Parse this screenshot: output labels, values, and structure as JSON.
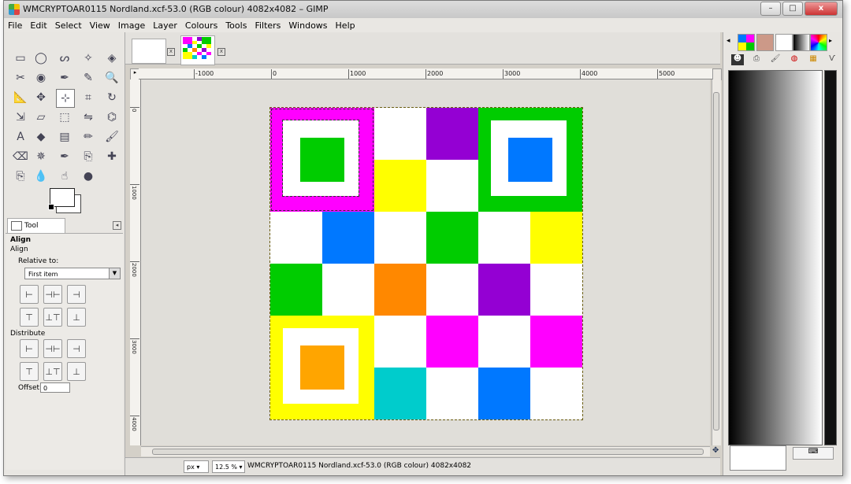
{
  "window": {
    "title": "WMCRYPTOAR0115 Nordland.xcf-53.0 (RGB colour) 4082x4082 – GIMP",
    "buttons": {
      "minimize": "–",
      "maximize": "□",
      "close": "x"
    }
  },
  "menu": [
    "File",
    "Edit",
    "Select",
    "View",
    "Image",
    "Layer",
    "Colours",
    "Tools",
    "Filters",
    "Windows",
    "Help"
  ],
  "toolbox": {
    "tools": [
      "rect-select-icon",
      "ellipse-select-icon",
      "lasso-icon",
      "fuzzy-select-icon",
      "color-select-icon",
      "scissors-icon",
      "foreground-select-icon",
      "paths-icon",
      "color-picker-icon",
      "zoom-icon",
      "measure-icon",
      "move-icon",
      "align-icon",
      "crop-icon",
      "rotate-icon",
      "scale-icon",
      "shear-icon",
      "perspective-icon",
      "flip-icon",
      "cage-icon",
      "text-icon",
      "bucket-fill-icon",
      "blend-icon",
      "pencil-icon",
      "paintbrush-icon",
      "eraser-icon",
      "airbrush-icon",
      "ink-icon",
      "clone-icon",
      "heal-icon",
      "perspective-clone-icon",
      "blur-icon",
      "smudge-icon",
      "dodge-burn-icon"
    ],
    "glyphs": [
      "▭",
      "◯",
      "ᔕ",
      "✧",
      "◈",
      "✂",
      "◉",
      "✒",
      "✎",
      "🔍",
      "📐",
      "✥",
      "⊹",
      "⌗",
      "↻",
      "⇲",
      "▱",
      "⬚",
      "⇋",
      "⌬",
      "A",
      "◆",
      "▤",
      "✏",
      "🖌",
      "⌫",
      "✵",
      "✒",
      "⎘",
      "✚",
      "⎘",
      "💧",
      "☝",
      "●"
    ],
    "selected_index": 12
  },
  "tool_options": {
    "tab_label": "Tool Options",
    "heading": "Align",
    "subheading": "Align",
    "relative_to_label": "Relative to:",
    "relative_to_value": "First item",
    "distribute_label": "Distribute",
    "offset_label": "Offset:",
    "offset_value": "0",
    "align_glyphs": [
      "⊢",
      "⊣⊢",
      "⊣",
      "⊤",
      "⊥⊤",
      "⊥"
    ]
  },
  "image_tabs": {
    "close_glyph": "x"
  },
  "ruler": {
    "h_labels": [
      "-1000",
      "0",
      "1000",
      "2000",
      "3000",
      "4000",
      "5000"
    ],
    "v_labels": [
      "0",
      "1000",
      "2000",
      "3000",
      "4000"
    ]
  },
  "image": {
    "colors": {
      "magenta": "#ff00ff",
      "green": "#00cc00",
      "purple": "#9400d3",
      "blue": "#0078ff",
      "yellow": "#ffff00",
      "orange": "#ff8800",
      "gold": "#ffa500",
      "cyan": "#00cccc",
      "white": "#ffffff"
    }
  },
  "statusbar": {
    "unit": "px",
    "zoom": "12.5 %",
    "text": "WMCRYPTOAR0115 Nordland.xcf-53.0 (RGB colour) 4082x4082"
  }
}
